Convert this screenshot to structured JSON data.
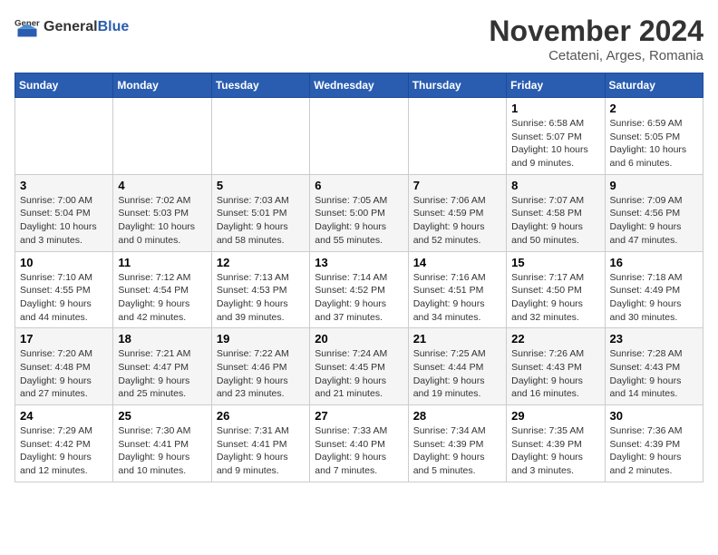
{
  "logo": {
    "general": "General",
    "blue": "Blue"
  },
  "title": "November 2024",
  "subtitle": "Cetateni, Arges, Romania",
  "weekdays": [
    "Sunday",
    "Monday",
    "Tuesday",
    "Wednesday",
    "Thursday",
    "Friday",
    "Saturday"
  ],
  "weeks": [
    [
      {
        "day": "",
        "info": ""
      },
      {
        "day": "",
        "info": ""
      },
      {
        "day": "",
        "info": ""
      },
      {
        "day": "",
        "info": ""
      },
      {
        "day": "",
        "info": ""
      },
      {
        "day": "1",
        "info": "Sunrise: 6:58 AM\nSunset: 5:07 PM\nDaylight: 10 hours and 9 minutes."
      },
      {
        "day": "2",
        "info": "Sunrise: 6:59 AM\nSunset: 5:05 PM\nDaylight: 10 hours and 6 minutes."
      }
    ],
    [
      {
        "day": "3",
        "info": "Sunrise: 7:00 AM\nSunset: 5:04 PM\nDaylight: 10 hours and 3 minutes."
      },
      {
        "day": "4",
        "info": "Sunrise: 7:02 AM\nSunset: 5:03 PM\nDaylight: 10 hours and 0 minutes."
      },
      {
        "day": "5",
        "info": "Sunrise: 7:03 AM\nSunset: 5:01 PM\nDaylight: 9 hours and 58 minutes."
      },
      {
        "day": "6",
        "info": "Sunrise: 7:05 AM\nSunset: 5:00 PM\nDaylight: 9 hours and 55 minutes."
      },
      {
        "day": "7",
        "info": "Sunrise: 7:06 AM\nSunset: 4:59 PM\nDaylight: 9 hours and 52 minutes."
      },
      {
        "day": "8",
        "info": "Sunrise: 7:07 AM\nSunset: 4:58 PM\nDaylight: 9 hours and 50 minutes."
      },
      {
        "day": "9",
        "info": "Sunrise: 7:09 AM\nSunset: 4:56 PM\nDaylight: 9 hours and 47 minutes."
      }
    ],
    [
      {
        "day": "10",
        "info": "Sunrise: 7:10 AM\nSunset: 4:55 PM\nDaylight: 9 hours and 44 minutes."
      },
      {
        "day": "11",
        "info": "Sunrise: 7:12 AM\nSunset: 4:54 PM\nDaylight: 9 hours and 42 minutes."
      },
      {
        "day": "12",
        "info": "Sunrise: 7:13 AM\nSunset: 4:53 PM\nDaylight: 9 hours and 39 minutes."
      },
      {
        "day": "13",
        "info": "Sunrise: 7:14 AM\nSunset: 4:52 PM\nDaylight: 9 hours and 37 minutes."
      },
      {
        "day": "14",
        "info": "Sunrise: 7:16 AM\nSunset: 4:51 PM\nDaylight: 9 hours and 34 minutes."
      },
      {
        "day": "15",
        "info": "Sunrise: 7:17 AM\nSunset: 4:50 PM\nDaylight: 9 hours and 32 minutes."
      },
      {
        "day": "16",
        "info": "Sunrise: 7:18 AM\nSunset: 4:49 PM\nDaylight: 9 hours and 30 minutes."
      }
    ],
    [
      {
        "day": "17",
        "info": "Sunrise: 7:20 AM\nSunset: 4:48 PM\nDaylight: 9 hours and 27 minutes."
      },
      {
        "day": "18",
        "info": "Sunrise: 7:21 AM\nSunset: 4:47 PM\nDaylight: 9 hours and 25 minutes."
      },
      {
        "day": "19",
        "info": "Sunrise: 7:22 AM\nSunset: 4:46 PM\nDaylight: 9 hours and 23 minutes."
      },
      {
        "day": "20",
        "info": "Sunrise: 7:24 AM\nSunset: 4:45 PM\nDaylight: 9 hours and 21 minutes."
      },
      {
        "day": "21",
        "info": "Sunrise: 7:25 AM\nSunset: 4:44 PM\nDaylight: 9 hours and 19 minutes."
      },
      {
        "day": "22",
        "info": "Sunrise: 7:26 AM\nSunset: 4:43 PM\nDaylight: 9 hours and 16 minutes."
      },
      {
        "day": "23",
        "info": "Sunrise: 7:28 AM\nSunset: 4:43 PM\nDaylight: 9 hours and 14 minutes."
      }
    ],
    [
      {
        "day": "24",
        "info": "Sunrise: 7:29 AM\nSunset: 4:42 PM\nDaylight: 9 hours and 12 minutes."
      },
      {
        "day": "25",
        "info": "Sunrise: 7:30 AM\nSunset: 4:41 PM\nDaylight: 9 hours and 10 minutes."
      },
      {
        "day": "26",
        "info": "Sunrise: 7:31 AM\nSunset: 4:41 PM\nDaylight: 9 hours and 9 minutes."
      },
      {
        "day": "27",
        "info": "Sunrise: 7:33 AM\nSunset: 4:40 PM\nDaylight: 9 hours and 7 minutes."
      },
      {
        "day": "28",
        "info": "Sunrise: 7:34 AM\nSunset: 4:39 PM\nDaylight: 9 hours and 5 minutes."
      },
      {
        "day": "29",
        "info": "Sunrise: 7:35 AM\nSunset: 4:39 PM\nDaylight: 9 hours and 3 minutes."
      },
      {
        "day": "30",
        "info": "Sunrise: 7:36 AM\nSunset: 4:39 PM\nDaylight: 9 hours and 2 minutes."
      }
    ]
  ]
}
